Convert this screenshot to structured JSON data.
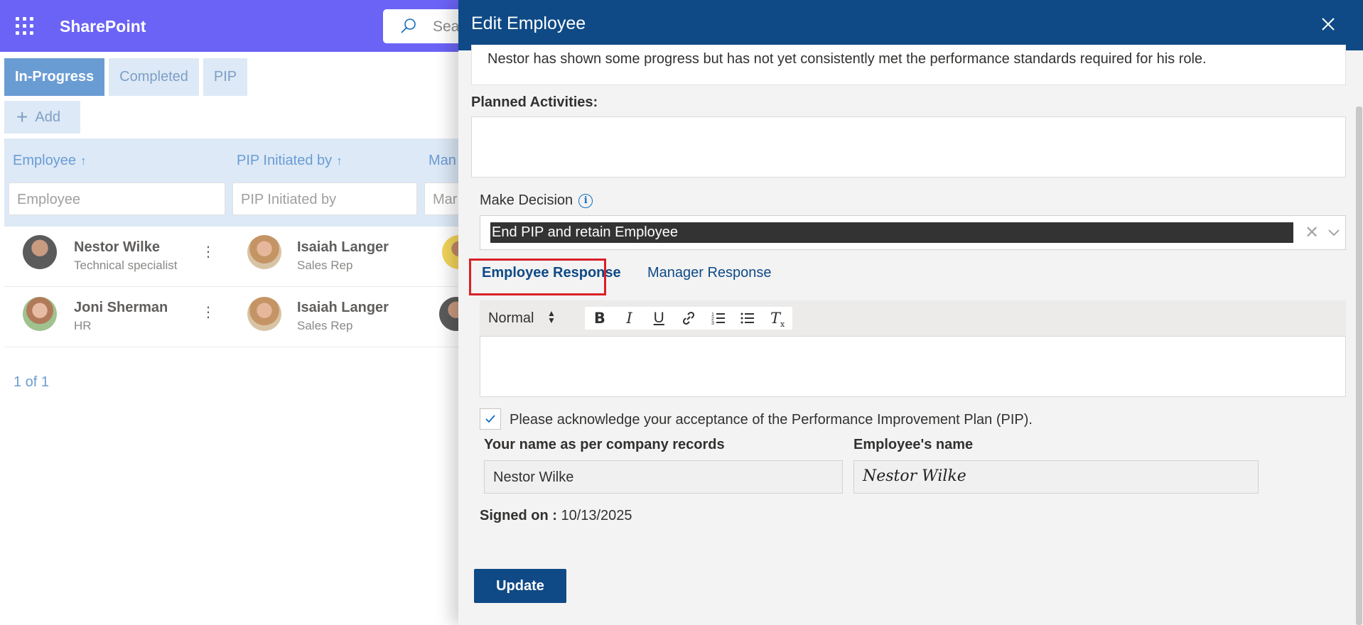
{
  "app": {
    "brand": "SharePoint",
    "search_placeholder": "Sea"
  },
  "list": {
    "tabs": [
      {
        "label": "In-Progress",
        "active": true
      },
      {
        "label": "Completed",
        "active": false
      },
      {
        "label": "PIP",
        "active": false
      }
    ],
    "add_label": "Add",
    "columns": [
      {
        "label": "Employee",
        "sort_icon": "↑",
        "filter_placeholder": "Employee"
      },
      {
        "label": "PIP Initiated by",
        "sort_icon": "↑",
        "filter_placeholder": "PIP Initiated by"
      },
      {
        "label": "Man",
        "filter_placeholder": "Mar"
      }
    ],
    "rows": [
      {
        "employee": "Nestor Wilke",
        "employee_role": "Technical specialist",
        "initiator": "Isaiah Langer",
        "initiator_role": "Sales Rep"
      },
      {
        "employee": "Joni Sherman",
        "employee_role": "HR",
        "initiator": "Isaiah Langer",
        "initiator_role": "Sales Rep"
      }
    ],
    "pager": "1 of 1"
  },
  "panel": {
    "title": "Edit Employee",
    "previous_text": "Nestor has shown some progress but has not yet consistently met the performance standards required for his role.",
    "planned_activities_label": "Planned Activities:",
    "make_decision_label": "Make Decision",
    "decision_value": "End PIP and retain Employee",
    "response_tabs": {
      "employee": "Employee Response",
      "manager": "Manager Response"
    },
    "toolbar": {
      "format": "Normal",
      "buttons": [
        "bold-icon",
        "italic-icon",
        "underline-icon",
        "link-icon",
        "ordered-list-icon",
        "bullet-list-icon",
        "clear-format-icon"
      ]
    },
    "acknowledge_text": "Please acknowledge your acceptance of the Performance Improvement Plan (PIP).",
    "acknowledge_checked": true,
    "name_label": "Your name as per company records",
    "name_value": "Nestor Wilke",
    "signature_label": "Employee's name",
    "signature_value": "Nestor Wilke",
    "signed_on_label": "Signed on :",
    "signed_on_value": "10/13/2025",
    "update_label": "Update"
  },
  "colors": {
    "suite_bar": "#6b63f6",
    "panel_header": "#0f4a86",
    "highlight": "#d92027"
  }
}
